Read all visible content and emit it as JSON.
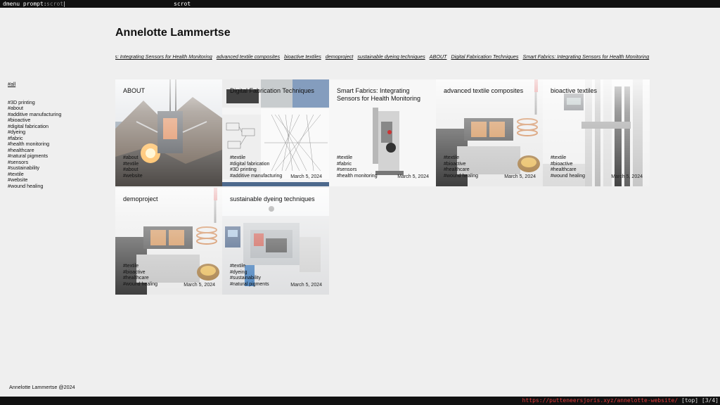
{
  "dmenu": {
    "prompt": "dmenu prompt:",
    "input": "scrot",
    "item": "scrot"
  },
  "site": {
    "title": "Annelotte Lammertse",
    "footer": "Annelotte Lammertse @2024"
  },
  "nav": [
    "Smart Fabrics: Integrating Sensors for Health Monitoring",
    "advanced textile composites",
    "bioactive textiles",
    "demoproject",
    "sustainable dyeing techniques",
    "ABOUT",
    "Digital Fabrication Techniques",
    "Smart Fabrics: Integrating Sensors for Health Monitoring"
  ],
  "sidebar": {
    "all": "#all",
    "tags": [
      "#3D printing",
      "#about",
      "#additive manufacturing",
      "#bioactive",
      "#digital fabrication",
      "#dyeing",
      "#fabric",
      "#health monitoring",
      "#healthcare",
      "#natural pigments",
      "#sensors",
      "#sustainability",
      "#textile",
      "#website",
      "#wound healing"
    ]
  },
  "cards": [
    {
      "title": "ABOUT",
      "tags": [
        "#about",
        "#textile",
        "#about",
        "#website"
      ],
      "date": ""
    },
    {
      "title": "Digital Fabrication Techniques",
      "tags": [
        "#textile",
        "#digital fabrication",
        "#3D printing",
        "#additive manufacturing"
      ],
      "date": "March 5, 2024"
    },
    {
      "title": "Smart Fabrics: Integrating Sensors for Health Monitoring",
      "tags": [
        "#textile",
        "#fabric",
        "#sensors",
        "#health monitoring"
      ],
      "date": "March 5, 2024"
    },
    {
      "title": "advanced textile composites",
      "tags": [
        "#textile",
        "#bioactive",
        "#healthcare",
        "#wound healing"
      ],
      "date": "March 5, 2024"
    },
    {
      "title": "bioactive textiles",
      "tags": [
        "#textile",
        "#bioactive",
        "#healthcare",
        "#wound healing"
      ],
      "date": "March 5, 2024"
    },
    {
      "title": "demoproject",
      "tags": [
        "#textile",
        "#bioactive",
        "#healthcare",
        "#wound healing"
      ],
      "date": "March 5, 2024"
    },
    {
      "title": "sustainable dyeing techniques",
      "tags": [
        "#textile",
        "#dyeing",
        "#sustainability",
        "#natural pigments"
      ],
      "date": "March 5, 2024"
    }
  ],
  "statusbar": {
    "url": "https://putteneersjoris.xyz/annelotte-website/",
    "position": "[top] [3/4]"
  }
}
